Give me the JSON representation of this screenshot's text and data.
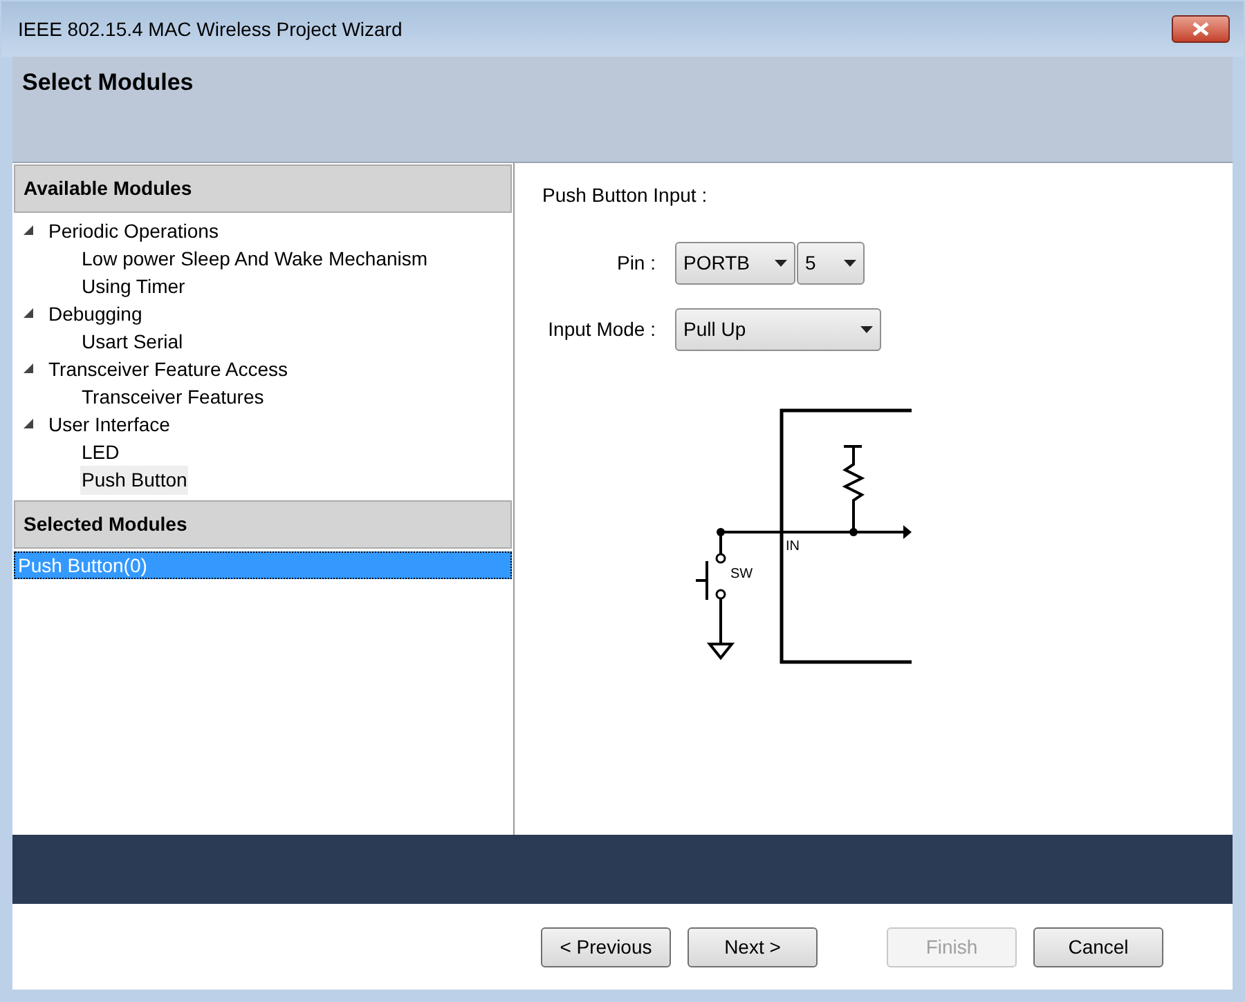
{
  "window": {
    "title": "IEEE 802.15.4 MAC Wireless Project Wizard"
  },
  "header": {
    "title": "Select Modules"
  },
  "available_modules": {
    "title": "Available Modules",
    "tree": [
      {
        "label": "Periodic Operations",
        "expanded": true,
        "children": [
          {
            "label": "Low power Sleep And Wake Mechanism",
            "selected": false
          },
          {
            "label": "Using Timer",
            "selected": false
          }
        ]
      },
      {
        "label": "Debugging",
        "expanded": true,
        "children": [
          {
            "label": "Usart Serial",
            "selected": false
          }
        ]
      },
      {
        "label": "Transceiver Feature Access",
        "expanded": true,
        "children": [
          {
            "label": "Transceiver Features",
            "selected": false
          }
        ]
      },
      {
        "label": "User Interface",
        "expanded": true,
        "children": [
          {
            "label": "LED",
            "selected": false
          },
          {
            "label": "Push Button",
            "selected": true
          }
        ]
      }
    ]
  },
  "selected_modules": {
    "title": "Selected Modules",
    "items": [
      {
        "label": "Push Button(0)",
        "selected": true
      }
    ]
  },
  "config": {
    "title": "Push Button Input :",
    "pin_label": "Pin :",
    "port": "PORTB",
    "pin": "5",
    "mode_label": "Input Mode :",
    "mode": "Pull Up",
    "diagram_labels": [
      "IN",
      "SW"
    ]
  },
  "buttons": [
    {
      "label": "< Previous",
      "disabled": false
    },
    {
      "label": "Next >",
      "disabled": false
    },
    {
      "label": "Finish",
      "disabled": true
    },
    {
      "label": "Cancel",
      "disabled": false
    }
  ]
}
